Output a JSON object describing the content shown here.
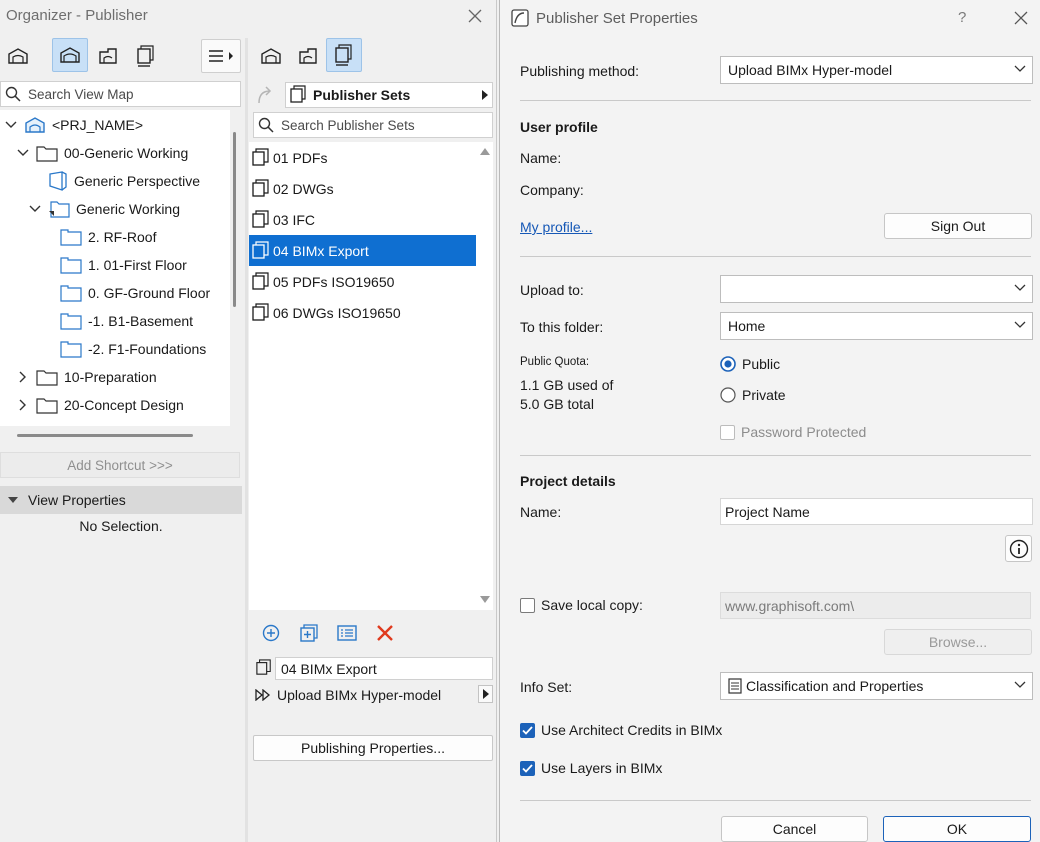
{
  "organizer": {
    "title": "Organizer - Publisher",
    "search_view_map_placeholder": "Search View Map",
    "tree": [
      {
        "label": "<PRJ_NAME>"
      },
      {
        "label": "00-Generic Working"
      },
      {
        "label": "Generic Perspective"
      },
      {
        "label": "Generic Working"
      },
      {
        "label": "2. RF-Roof"
      },
      {
        "label": "1. 01-First Floor"
      },
      {
        "label": "0. GF-Ground Floor"
      },
      {
        "label": "-1. B1-Basement"
      },
      {
        "label": "-2. F1-Foundations"
      },
      {
        "label": "10-Preparation"
      },
      {
        "label": "20-Concept Design"
      }
    ],
    "add_shortcut_label": "Add Shortcut >>>",
    "view_properties_label": "View Properties",
    "no_selection_text": "No Selection.",
    "publisher_sets_label": "Publisher Sets",
    "search_publisher_sets_placeholder": "Search Publisher Sets",
    "publisher_items": [
      {
        "label": "01 PDFs"
      },
      {
        "label": "02 DWGs"
      },
      {
        "label": "03 IFC"
      },
      {
        "label": "04 BIMx Export"
      },
      {
        "label": "05 PDFs ISO19650"
      },
      {
        "label": "06 DWGs ISO19650"
      }
    ],
    "selected_set_name": "04 BIMx Export",
    "selected_set_method": "Upload BIMx Hyper-model",
    "publishing_properties_label": "Publishing Properties..."
  },
  "dialog": {
    "title": "Publisher Set Properties",
    "help_label": "?",
    "publishing_method_label": "Publishing method:",
    "publishing_method_value": "Upload BIMx Hyper-model",
    "user_profile_title": "User profile",
    "name_label": "Name:",
    "company_label": "Company:",
    "my_profile_link": "My profile...",
    "sign_out_label": "Sign Out",
    "upload_to_label": "Upload to:",
    "upload_to_value": "",
    "to_this_folder_label": "To this folder:",
    "to_this_folder_value": "Home",
    "public_quota_label": "Public Quota:",
    "quota_used": "1.1 GB used of",
    "quota_total": "5.0 GB total",
    "radio_public": "Public",
    "radio_private": "Private",
    "password_protected": "Password Protected",
    "project_details_title": "Project details",
    "project_name_label": "Name:",
    "project_name_value": "Project Name",
    "save_local_copy_label": "Save local copy:",
    "local_path_value": "www.graphisoft.com\\",
    "browse_label": "Browse...",
    "info_set_label": "Info Set:",
    "info_set_value": "Classification and Properties",
    "use_architect_credits": "Use Architect Credits in BIMx",
    "use_layers": "Use Layers in BIMx",
    "cancel_label": "Cancel",
    "ok_label": "OK"
  }
}
